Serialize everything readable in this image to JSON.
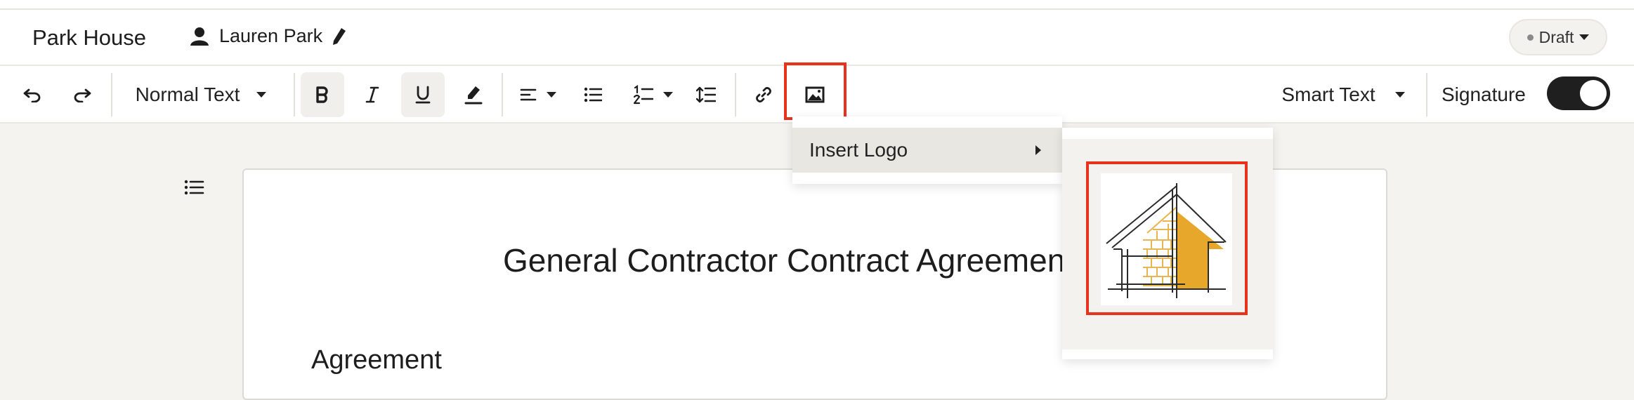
{
  "header": {
    "brand": "Park House",
    "user_name": "Lauren Park",
    "status": "Draft"
  },
  "toolbar": {
    "text_style": "Normal Text",
    "smart_text": "Smart Text",
    "signature_label": "Signature",
    "signature_enabled": true
  },
  "menu": {
    "insert_logo": "Insert Logo"
  },
  "document": {
    "title": "General Contractor Contract Agreement",
    "section_heading": "Agreement"
  },
  "colors": {
    "highlight": "#e8331c",
    "logo_accent": "#e7a72b",
    "toggle_on": "#1f1f1f"
  },
  "icons": [
    "undo-icon",
    "redo-icon",
    "bold-icon",
    "italic-icon",
    "underline-icon",
    "highlighter-icon",
    "align-left-icon",
    "bullet-list-icon",
    "numbered-list-icon",
    "line-spacing-icon",
    "link-icon",
    "image-icon",
    "outline-icon",
    "user-icon",
    "pencil-icon"
  ]
}
